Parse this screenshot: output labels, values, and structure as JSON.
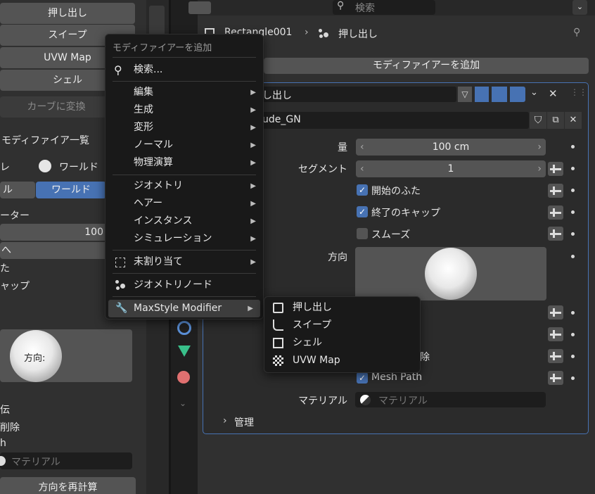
{
  "left_panel": {
    "buttons": [
      "押し出し",
      "スイープ",
      "UVW Map",
      "シェル"
    ],
    "convert_curve": "カーブに変換",
    "modifier_list": "モディファイア一覧",
    "world_label": "ワールド",
    "local_partial": "ル",
    "world_tab": "ワールド",
    "param_partial": "ーター",
    "value_100": "100",
    "row_a": "へ",
    "row_b": "た",
    "row_c": "ャップ",
    "direction": "方向:",
    "row_d": "伝",
    "row_e": "削除",
    "row_f": "h",
    "material_placeholder": "マテリアル",
    "recalc": "方向を再計算",
    "left_cut": "レ"
  },
  "header": {
    "search_placeholder": "検索",
    "object_name": "Rectangle001",
    "modifier_name": "押し出し"
  },
  "main": {
    "add_modifier": "モディファイアーを追加",
    "modifier_title": "し出し",
    "node_group": "ude_GN",
    "params": [
      {
        "label": "量",
        "value": "100 cm"
      },
      {
        "label": "セグメント",
        "value": "1"
      }
    ],
    "checks": [
      {
        "label": "開始のふた",
        "checked": true
      },
      {
        "label": "終了のキャップ",
        "checked": true
      },
      {
        "label": "スムーズ",
        "checked": false
      }
    ],
    "direction_label": "方向",
    "partial_delete": "除",
    "mesh_path": "Mesh Path",
    "material_label": "マテリアル",
    "material_placeholder": "マテリアル",
    "manage": "管理"
  },
  "menu": {
    "title": "モディファイアーを追加",
    "search": "検索...",
    "items_a": [
      "編集",
      "生成",
      "変形",
      "ノーマル",
      "物理演算"
    ],
    "items_b": [
      "ジオメトリ",
      "ヘアー",
      "インスタンス",
      "シミュレーション"
    ],
    "unassigned": "未割り当て",
    "geometry_nodes": "ジオメトリノード",
    "maxstyle": "MaxStyle Modifier"
  },
  "submenu": {
    "items": [
      "押し出し",
      "スイープ",
      "シェル",
      "UVW Map"
    ]
  },
  "colors": {
    "accent": "#4772b3",
    "menu_bg": "#191919",
    "panel_bg": "#303030"
  }
}
